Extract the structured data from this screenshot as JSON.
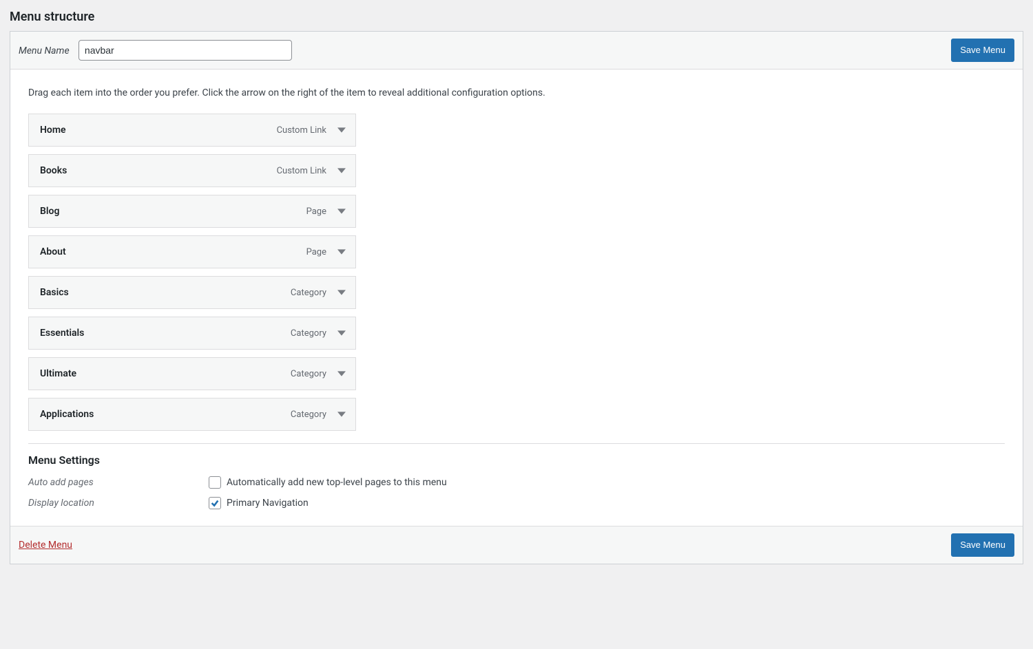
{
  "section_title": "Menu structure",
  "menu_name_label": "Menu Name",
  "menu_name_value": "navbar",
  "save_button": "Save Menu",
  "drag_instructions": "Drag each item into the order you prefer. Click the arrow on the right of the item to reveal additional configuration options.",
  "items": [
    {
      "title": "Home",
      "type": "Custom Link"
    },
    {
      "title": "Books",
      "type": "Custom Link"
    },
    {
      "title": "Blog",
      "type": "Page"
    },
    {
      "title": "About",
      "type": "Page"
    },
    {
      "title": "Basics",
      "type": "Category"
    },
    {
      "title": "Essentials",
      "type": "Category"
    },
    {
      "title": "Ultimate",
      "type": "Category"
    },
    {
      "title": "Applications",
      "type": "Category"
    }
  ],
  "settings_title": "Menu Settings",
  "settings": {
    "auto_add_label": "Auto add pages",
    "auto_add_checkbox_label": "Automatically add new top-level pages to this menu",
    "auto_add_checked": false,
    "display_location_label": "Display location",
    "display_location_checkbox_label": "Primary Navigation",
    "display_location_checked": true
  },
  "delete_menu": "Delete Menu"
}
